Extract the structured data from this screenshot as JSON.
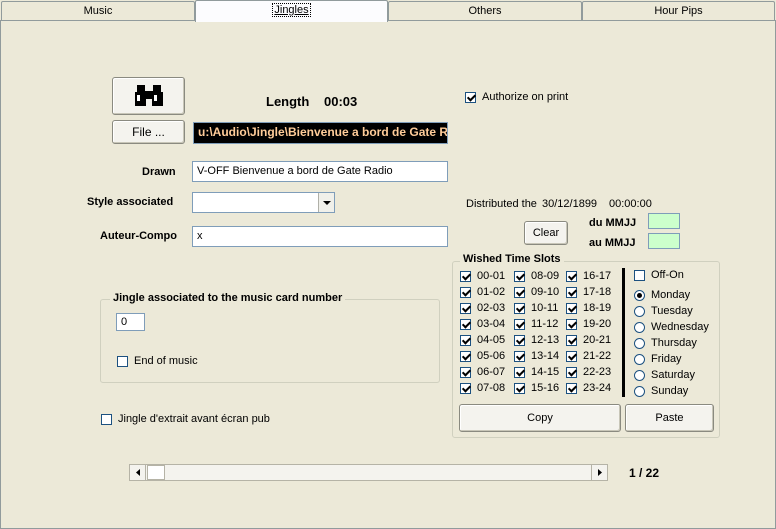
{
  "tabs": [
    "Music",
    "Jingles",
    "Others",
    "Hour Pips"
  ],
  "active_tab": 1,
  "file_button_label": "File ...",
  "length_label": "Length",
  "length_value": "00:03",
  "path_value": "u:\\Audio\\Jingle\\Bienvenue a bord de Gate Radio",
  "authorize_label": "Authorize on print",
  "authorize_checked": true,
  "drawn_label": "Drawn",
  "drawn_value": "V-OFF Bienvenue a bord de Gate Radio",
  "style_label": "Style associated",
  "style_value": "",
  "auteur_label": "Auteur-Compo",
  "auteur_value": "x",
  "distributed_label": "Distributed the",
  "distributed_date": "30/12/1899",
  "distributed_time": "00:00:00",
  "clear_label": "Clear",
  "du_label": "du MMJJ",
  "au_label": "au MMJJ",
  "jingle_group_title": "Jingle associated to the music card number",
  "card_number": "0",
  "end_of_music_label": "End of music",
  "extrait_label": "Jingle d'extrait avant écran pub",
  "wished_title": "Wished Time Slots",
  "slots_col1": [
    "00-01",
    "01-02",
    "02-03",
    "03-04",
    "04-05",
    "05-06",
    "06-07",
    "07-08"
  ],
  "slots_col2": [
    "08-09",
    "09-10",
    "10-11",
    "11-12",
    "12-13",
    "13-14",
    "14-15",
    "15-16"
  ],
  "slots_col3": [
    "16-17",
    "17-18",
    "18-19",
    "19-20",
    "20-21",
    "21-22",
    "22-23",
    "23-24"
  ],
  "offon_label": "Off-On",
  "days": [
    "Monday",
    "Tuesday",
    "Wednesday",
    "Thursday",
    "Friday",
    "Saturday",
    "Sunday"
  ],
  "selected_day": "Monday",
  "copy_label": "Copy",
  "paste_label": "Paste",
  "record_position": "1 / 22"
}
